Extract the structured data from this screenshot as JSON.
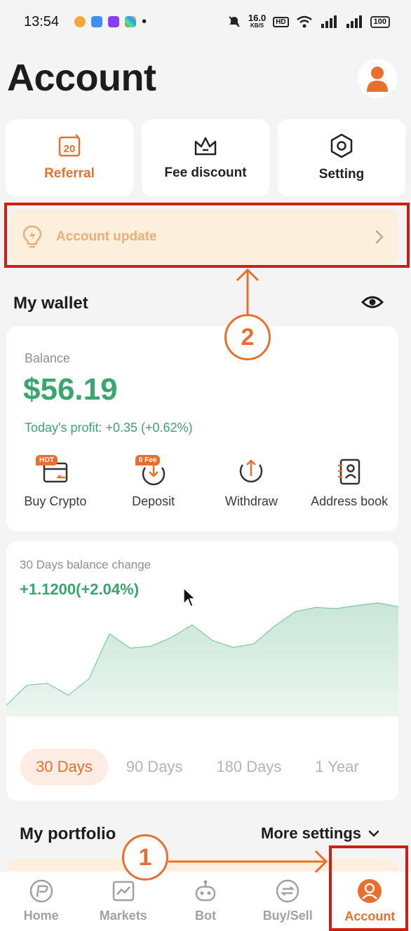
{
  "status_bar": {
    "time": "13:54",
    "network_speed": "16.0",
    "network_unit": "KB/S",
    "battery": "100"
  },
  "header": {
    "title": "Account",
    "avatar_icon": "user-icon"
  },
  "quick_actions": [
    {
      "label": "Referral",
      "icon": "calendar-20-icon"
    },
    {
      "label": "Fee discount",
      "icon": "crown-icon"
    },
    {
      "label": "Setting",
      "icon": "hexagon-settings-icon"
    }
  ],
  "banner": {
    "text": "Account update",
    "icon": "bulb-icon"
  },
  "wallet": {
    "title": "My wallet",
    "balance_label": "Balance",
    "balance": "$56.19",
    "profit": "Today's profit: +0.35 (+0.62%)",
    "actions": [
      {
        "label": "Buy Crypto",
        "badge": "HOT"
      },
      {
        "label": "Deposit",
        "badge": "0 Fee"
      },
      {
        "label": "Withdraw",
        "badge": ""
      },
      {
        "label": "Address book",
        "badge": ""
      }
    ]
  },
  "balance_chart": {
    "label": "30 Days balance change",
    "change": "+1.1200(+2.04%)",
    "ranges": [
      "30 Days",
      "90 Days",
      "180 Days",
      "1 Year"
    ],
    "selected_range": "30 Days"
  },
  "chart_data": {
    "type": "area",
    "title": "30 Days balance change",
    "values": [
      0,
      3.2,
      3.5,
      1.6,
      4.2,
      11.4,
      9.1,
      9.4,
      10.8,
      12.8,
      10.3,
      9.2,
      9.8,
      12.6,
      14.9,
      15.6,
      15.4,
      15.9,
      16.3,
      15.7
    ],
    "grid": false,
    "color": "#3aa66e"
  },
  "portfolio": {
    "title": "My portfolio",
    "more_settings": "More settings"
  },
  "tab_bar": {
    "tabs": [
      {
        "label": "Home",
        "icon": "home-logo-icon"
      },
      {
        "label": "Markets",
        "icon": "chart-icon"
      },
      {
        "label": "Bot",
        "icon": "robot-icon"
      },
      {
        "label": "Buy/Sell",
        "icon": "swap-icon"
      },
      {
        "label": "Account",
        "icon": "account-icon"
      }
    ],
    "active": "Account"
  },
  "annotations": {
    "step1": "1",
    "step2": "2"
  },
  "colors": {
    "accent": "#e8702e",
    "positive": "#3aa66e",
    "highlight": "#cc1f0f",
    "banner_bg": "#fcefdb"
  }
}
